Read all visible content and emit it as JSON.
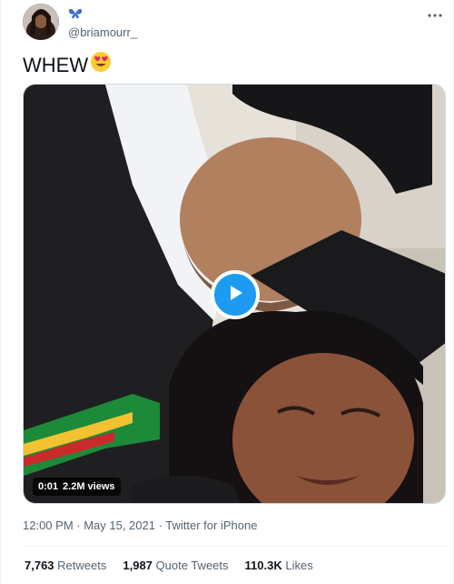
{
  "tweet": {
    "display_name_icon": "butterfly-icon",
    "handle": "@briamourr_",
    "text": "WHEW",
    "emoji": "heart-eyes-emoji",
    "video": {
      "time": "0:01",
      "views": "2.2M views"
    },
    "timestamp": "12:00 PM · May 15, 2021 · Twitter for iPhone",
    "stats": {
      "retweets_count": "7,763",
      "retweets_label": "Retweets",
      "quotes_count": "1,987",
      "quotes_label": "Quote Tweets",
      "likes_count": "110.3K",
      "likes_label": "Likes"
    }
  },
  "colors": {
    "accent": "#1d9bf0",
    "text_primary": "#0f1419",
    "text_secondary": "#536471",
    "border": "#eff3f4"
  }
}
